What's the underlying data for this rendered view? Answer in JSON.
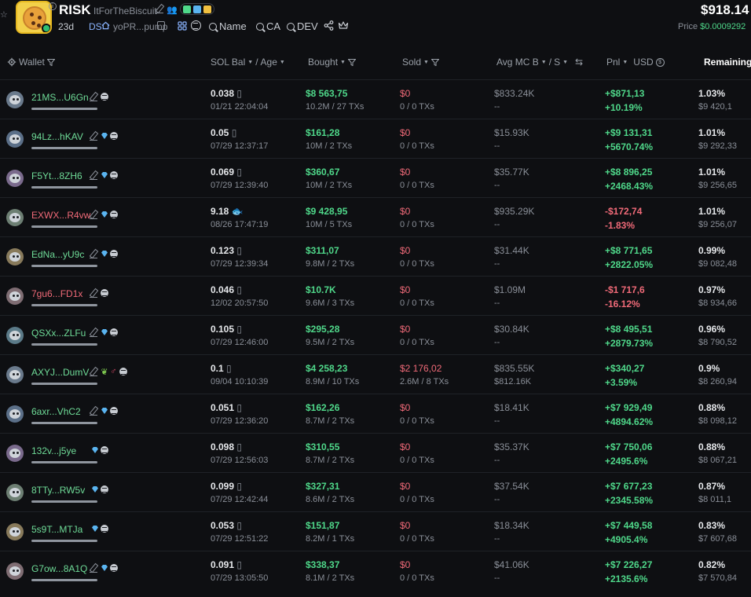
{
  "token": {
    "symbol": "RISK",
    "name": "ItForTheBiscuit",
    "age": "23d",
    "ds_label": "DS",
    "contract_short": "yoPR...pump",
    "price_main": "$918.14",
    "price_label": "Price",
    "price_value": "$0.0009292",
    "links": {
      "name": "Name",
      "ca": "CA",
      "dev": "DEV"
    }
  },
  "columns": {
    "wallet": "Wallet",
    "sol_bal": "SOL Bal",
    "age": "Age",
    "bought": "Bought",
    "sold": "Sold",
    "avg_mc": "Avg MC B",
    "avg_mc_s": "S",
    "pnl": "Pnl",
    "usd": "USD",
    "remaining": "Remaining"
  },
  "colors": {
    "background": "#0e0f12",
    "positive": "#4fd88a",
    "negative": "#f06a78",
    "muted": "#8a8f98",
    "diamond": "#5ab4f0"
  },
  "rows": [
    {
      "address": "21MS...U6Gn",
      "addr_color": "green",
      "diamond": false,
      "sol": "0.038",
      "sol_suffix": "",
      "time": "01/21 22:04:04",
      "bought": "$8 563,75",
      "bought_sub": "10.2M / 27 TXs",
      "sold": "$0",
      "sold_sub": "0 / 0 TXs",
      "mc": "$833.24K",
      "mc_sub": "--",
      "pnl": "+$871,13",
      "pnl_pct": "+10.19%",
      "pnl_sign": "pos",
      "remaining": "1.03%",
      "remaining_usd": "$9 420,1"
    },
    {
      "address": "94Lz...hKAV",
      "addr_color": "green",
      "diamond": true,
      "sol": "0.05",
      "sol_suffix": "",
      "time": "07/29 12:37:17",
      "bought": "$161,28",
      "bought_sub": "10M / 2 TXs",
      "sold": "$0",
      "sold_sub": "0 / 0 TXs",
      "mc": "$15.93K",
      "mc_sub": "--",
      "pnl": "+$9 131,31",
      "pnl_pct": "+5670.74%",
      "pnl_sign": "pos",
      "remaining": "1.01%",
      "remaining_usd": "$9 292,33"
    },
    {
      "address": "F5Yt...8ZH6",
      "addr_color": "green",
      "diamond": true,
      "sol": "0.069",
      "sol_suffix": "",
      "time": "07/29 12:39:40",
      "bought": "$360,67",
      "bought_sub": "10M / 2 TXs",
      "sold": "$0",
      "sold_sub": "0 / 0 TXs",
      "mc": "$35.77K",
      "mc_sub": "--",
      "pnl": "+$8 896,25",
      "pnl_pct": "+2468.43%",
      "pnl_sign": "pos",
      "remaining": "1.01%",
      "remaining_usd": "$9 256,65"
    },
    {
      "address": "EXWX...R4vw",
      "addr_color": "red",
      "diamond": true,
      "sol": "9.18",
      "sol_suffix": "fish",
      "time": "08/26 17:47:19",
      "bought": "$9 428,95",
      "bought_sub": "10M / 5 TXs",
      "sold": "$0",
      "sold_sub": "0 / 0 TXs",
      "mc": "$935.29K",
      "mc_sub": "--",
      "pnl": "-$172,74",
      "pnl_pct": "-1.83%",
      "pnl_sign": "neg",
      "remaining": "1.01%",
      "remaining_usd": "$9 256,07"
    },
    {
      "address": "EdNa...yU9c",
      "addr_color": "green",
      "diamond": true,
      "sol": "0.123",
      "sol_suffix": "",
      "time": "07/29 12:39:34",
      "bought": "$311,07",
      "bought_sub": "9.8M / 2 TXs",
      "sold": "$0",
      "sold_sub": "0 / 0 TXs",
      "mc": "$31.44K",
      "mc_sub": "--",
      "pnl": "+$8 771,65",
      "pnl_pct": "+2822.05%",
      "pnl_sign": "pos",
      "remaining": "0.99%",
      "remaining_usd": "$9 082,48"
    },
    {
      "address": "7gu6...FD1x",
      "addr_color": "red",
      "diamond": false,
      "sol": "0.046",
      "sol_suffix": "",
      "time": "12/02 20:57:50",
      "bought": "$10.7K",
      "bought_sub": "9.6M / 3 TXs",
      "sold": "$0",
      "sold_sub": "0 / 0 TXs",
      "mc": "$1.09M",
      "mc_sub": "--",
      "pnl": "-$1 717,6",
      "pnl_pct": "-16.12%",
      "pnl_sign": "neg",
      "remaining": "0.97%",
      "remaining_usd": "$8 934,66"
    },
    {
      "address": "QSXx...ZLFu",
      "addr_color": "green",
      "diamond": true,
      "sol": "0.105",
      "sol_suffix": "",
      "time": "07/29 12:46:00",
      "bought": "$295,28",
      "bought_sub": "9.5M / 2 TXs",
      "sold": "$0",
      "sold_sub": "0 / 0 TXs",
      "mc": "$30.84K",
      "mc_sub": "--",
      "pnl": "+$8 495,51",
      "pnl_pct": "+2879.73%",
      "pnl_sign": "pos",
      "remaining": "0.96%",
      "remaining_usd": "$8 790,52"
    },
    {
      "address": "AXYJ...DumV",
      "addr_color": "green",
      "diamond": false,
      "leaf": true,
      "sol": "0.1",
      "sol_suffix": "",
      "time": "09/04 10:10:39",
      "bought": "$4 258,23",
      "bought_sub": "8.9M / 10 TXs",
      "sold": "$2 176,02",
      "sold_sub": "2.6M / 8 TXs",
      "mc": "$835.55K",
      "mc_sub": "$812.16K",
      "pnl": "+$340,27",
      "pnl_pct": "+3.59%",
      "pnl_sign": "pos",
      "remaining": "0.9%",
      "remaining_usd": "$8 260,94"
    },
    {
      "address": "6axr...VhC2",
      "addr_color": "green",
      "diamond": true,
      "sol": "0.051",
      "sol_suffix": "",
      "time": "07/29 12:36:20",
      "bought": "$162,26",
      "bought_sub": "8.7M / 2 TXs",
      "sold": "$0",
      "sold_sub": "0 / 0 TXs",
      "mc": "$18.41K",
      "mc_sub": "--",
      "pnl": "+$7 929,49",
      "pnl_pct": "+4894.62%",
      "pnl_sign": "pos",
      "remaining": "0.88%",
      "remaining_usd": "$8 098,12"
    },
    {
      "address": "132v...j5ye",
      "addr_color": "green",
      "diamond": true,
      "no_pen": true,
      "sol": "0.098",
      "sol_suffix": "",
      "time": "07/29 12:56:03",
      "bought": "$310,55",
      "bought_sub": "8.7M / 2 TXs",
      "sold": "$0",
      "sold_sub": "0 / 0 TXs",
      "mc": "$35.37K",
      "mc_sub": "--",
      "pnl": "+$7 750,06",
      "pnl_pct": "+2495.6%",
      "pnl_sign": "pos",
      "remaining": "0.88%",
      "remaining_usd": "$8 067,21"
    },
    {
      "address": "8TTy...RW5v",
      "addr_color": "green",
      "diamond": true,
      "no_pen": true,
      "sol": "0.099",
      "sol_suffix": "",
      "time": "07/29 12:42:44",
      "bought": "$327,31",
      "bought_sub": "8.6M / 2 TXs",
      "sold": "$0",
      "sold_sub": "0 / 0 TXs",
      "mc": "$37.54K",
      "mc_sub": "--",
      "pnl": "+$7 677,23",
      "pnl_pct": "+2345.58%",
      "pnl_sign": "pos",
      "remaining": "0.87%",
      "remaining_usd": "$8 011,1"
    },
    {
      "address": "5s9T...MTJa",
      "addr_color": "green",
      "diamond": true,
      "no_pen": true,
      "sol": "0.053",
      "sol_suffix": "",
      "time": "07/29 12:51:22",
      "bought": "$151,87",
      "bought_sub": "8.2M / 1 TXs",
      "sold": "$0",
      "sold_sub": "0 / 0 TXs",
      "mc": "$18.34K",
      "mc_sub": "--",
      "pnl": "+$7 449,58",
      "pnl_pct": "+4905.4%",
      "pnl_sign": "pos",
      "remaining": "0.83%",
      "remaining_usd": "$7 607,68"
    },
    {
      "address": "G7ow...8A1Q",
      "addr_color": "green",
      "diamond": true,
      "sol": "0.091",
      "sol_suffix": "",
      "time": "07/29 13:05:50",
      "bought": "$338,37",
      "bought_sub": "8.1M / 2 TXs",
      "sold": "$0",
      "sold_sub": "0 / 0 TXs",
      "mc": "$41.06K",
      "mc_sub": "--",
      "pnl": "+$7 226,27",
      "pnl_pct": "+2135.6%",
      "pnl_sign": "pos",
      "remaining": "0.82%",
      "remaining_usd": "$7 570,84"
    }
  ]
}
